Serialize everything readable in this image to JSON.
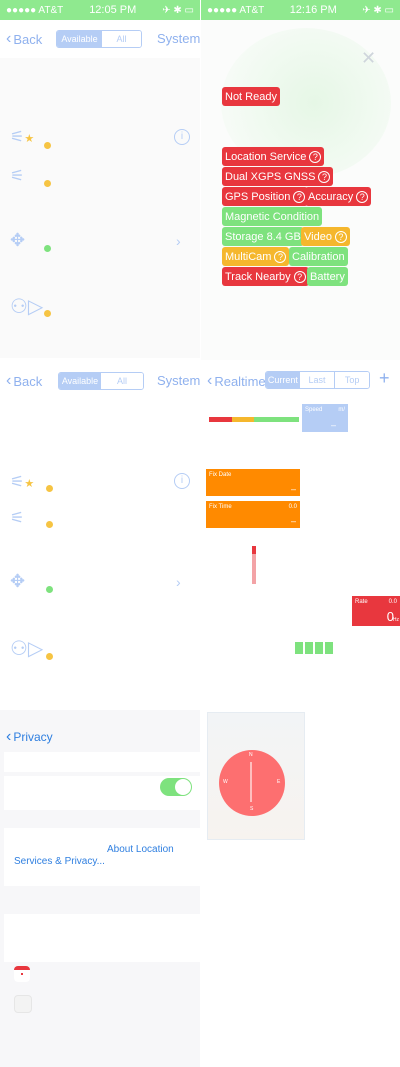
{
  "panel1": {
    "status": {
      "carrier": "●●●●● AT&T",
      "time": "12:05 PM",
      "right": "✈ ✱ ▭"
    },
    "nav": {
      "back": "Back",
      "seg_available": "Available",
      "seg_all": "All",
      "system": "System"
    }
  },
  "panel2": {
    "status": {
      "carrier": "●●●●● AT&T",
      "time": "12:16 PM",
      "right": "✈ ✱ ▭"
    },
    "badges": {
      "not_ready": "Not Ready",
      "location_service": "Location Service",
      "dual_xgps": "Dual XGPS GNSS",
      "gps_position": "GPS Position",
      "accuracy": "Accuracy",
      "magnetic": "Magnetic Condition",
      "storage": "Storage 8.4 GB",
      "video": "Video",
      "multicam": "MultiCam",
      "calibration": "Calibration",
      "track_nearby": "Track Nearby",
      "battery": "Battery"
    }
  },
  "panel3": {
    "nav": {
      "back": "Back",
      "seg_available": "Available",
      "seg_all": "All",
      "system": "System"
    }
  },
  "panel4": {
    "nav": {
      "realtime": "Realtime",
      "seg_current": "Current",
      "seg_last": "Last",
      "seg_top": "Top",
      "add": "+"
    },
    "speed": {
      "label": "Speed",
      "unit": "m/",
      "value": "–"
    },
    "fix_date": {
      "label": "Fix Date",
      "value": "–"
    },
    "fix_time": {
      "label": "Fix Time",
      "value": "0.0",
      "sub": "–"
    },
    "rate": {
      "label": "Rate",
      "value_top": "0.0",
      "value": "0",
      "unit": "Hz"
    }
  },
  "panel5": {
    "nav": {
      "back": "Privacy"
    },
    "link_text_1": "About Location",
    "link_text_2": "Services & Privacy..."
  },
  "panel6": {
    "compass": {
      "n": "N",
      "e": "E",
      "s": "S",
      "w": "W"
    }
  },
  "colors": {
    "red": "#e8373e",
    "green": "#7ee27e",
    "yellow": "#f5b72d",
    "orange": "#ff8a00",
    "blue": "#8fb1ee"
  }
}
